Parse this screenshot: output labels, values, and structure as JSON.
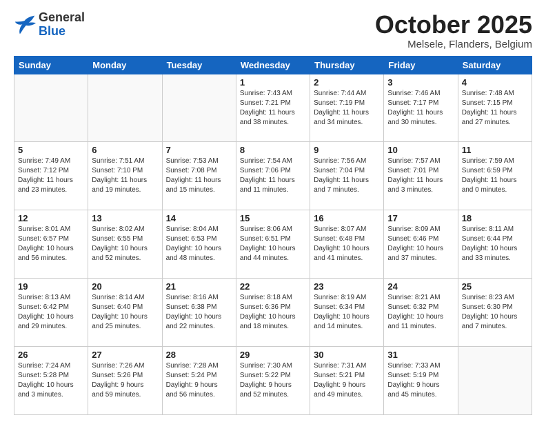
{
  "logo": {
    "general": "General",
    "blue": "Blue"
  },
  "header": {
    "month_year": "October 2025",
    "location": "Melsele, Flanders, Belgium"
  },
  "weekdays": [
    "Sunday",
    "Monday",
    "Tuesday",
    "Wednesday",
    "Thursday",
    "Friday",
    "Saturday"
  ],
  "weeks": [
    [
      {
        "day": "",
        "info": ""
      },
      {
        "day": "",
        "info": ""
      },
      {
        "day": "",
        "info": ""
      },
      {
        "day": "1",
        "info": "Sunrise: 7:43 AM\nSunset: 7:21 PM\nDaylight: 11 hours\nand 38 minutes."
      },
      {
        "day": "2",
        "info": "Sunrise: 7:44 AM\nSunset: 7:19 PM\nDaylight: 11 hours\nand 34 minutes."
      },
      {
        "day": "3",
        "info": "Sunrise: 7:46 AM\nSunset: 7:17 PM\nDaylight: 11 hours\nand 30 minutes."
      },
      {
        "day": "4",
        "info": "Sunrise: 7:48 AM\nSunset: 7:15 PM\nDaylight: 11 hours\nand 27 minutes."
      }
    ],
    [
      {
        "day": "5",
        "info": "Sunrise: 7:49 AM\nSunset: 7:12 PM\nDaylight: 11 hours\nand 23 minutes."
      },
      {
        "day": "6",
        "info": "Sunrise: 7:51 AM\nSunset: 7:10 PM\nDaylight: 11 hours\nand 19 minutes."
      },
      {
        "day": "7",
        "info": "Sunrise: 7:53 AM\nSunset: 7:08 PM\nDaylight: 11 hours\nand 15 minutes."
      },
      {
        "day": "8",
        "info": "Sunrise: 7:54 AM\nSunset: 7:06 PM\nDaylight: 11 hours\nand 11 minutes."
      },
      {
        "day": "9",
        "info": "Sunrise: 7:56 AM\nSunset: 7:04 PM\nDaylight: 11 hours\nand 7 minutes."
      },
      {
        "day": "10",
        "info": "Sunrise: 7:57 AM\nSunset: 7:01 PM\nDaylight: 11 hours\nand 3 minutes."
      },
      {
        "day": "11",
        "info": "Sunrise: 7:59 AM\nSunset: 6:59 PM\nDaylight: 11 hours\nand 0 minutes."
      }
    ],
    [
      {
        "day": "12",
        "info": "Sunrise: 8:01 AM\nSunset: 6:57 PM\nDaylight: 10 hours\nand 56 minutes."
      },
      {
        "day": "13",
        "info": "Sunrise: 8:02 AM\nSunset: 6:55 PM\nDaylight: 10 hours\nand 52 minutes."
      },
      {
        "day": "14",
        "info": "Sunrise: 8:04 AM\nSunset: 6:53 PM\nDaylight: 10 hours\nand 48 minutes."
      },
      {
        "day": "15",
        "info": "Sunrise: 8:06 AM\nSunset: 6:51 PM\nDaylight: 10 hours\nand 44 minutes."
      },
      {
        "day": "16",
        "info": "Sunrise: 8:07 AM\nSunset: 6:48 PM\nDaylight: 10 hours\nand 41 minutes."
      },
      {
        "day": "17",
        "info": "Sunrise: 8:09 AM\nSunset: 6:46 PM\nDaylight: 10 hours\nand 37 minutes."
      },
      {
        "day": "18",
        "info": "Sunrise: 8:11 AM\nSunset: 6:44 PM\nDaylight: 10 hours\nand 33 minutes."
      }
    ],
    [
      {
        "day": "19",
        "info": "Sunrise: 8:13 AM\nSunset: 6:42 PM\nDaylight: 10 hours\nand 29 minutes."
      },
      {
        "day": "20",
        "info": "Sunrise: 8:14 AM\nSunset: 6:40 PM\nDaylight: 10 hours\nand 25 minutes."
      },
      {
        "day": "21",
        "info": "Sunrise: 8:16 AM\nSunset: 6:38 PM\nDaylight: 10 hours\nand 22 minutes."
      },
      {
        "day": "22",
        "info": "Sunrise: 8:18 AM\nSunset: 6:36 PM\nDaylight: 10 hours\nand 18 minutes."
      },
      {
        "day": "23",
        "info": "Sunrise: 8:19 AM\nSunset: 6:34 PM\nDaylight: 10 hours\nand 14 minutes."
      },
      {
        "day": "24",
        "info": "Sunrise: 8:21 AM\nSunset: 6:32 PM\nDaylight: 10 hours\nand 11 minutes."
      },
      {
        "day": "25",
        "info": "Sunrise: 8:23 AM\nSunset: 6:30 PM\nDaylight: 10 hours\nand 7 minutes."
      }
    ],
    [
      {
        "day": "26",
        "info": "Sunrise: 7:24 AM\nSunset: 5:28 PM\nDaylight: 10 hours\nand 3 minutes."
      },
      {
        "day": "27",
        "info": "Sunrise: 7:26 AM\nSunset: 5:26 PM\nDaylight: 9 hours\nand 59 minutes."
      },
      {
        "day": "28",
        "info": "Sunrise: 7:28 AM\nSunset: 5:24 PM\nDaylight: 9 hours\nand 56 minutes."
      },
      {
        "day": "29",
        "info": "Sunrise: 7:30 AM\nSunset: 5:22 PM\nDaylight: 9 hours\nand 52 minutes."
      },
      {
        "day": "30",
        "info": "Sunrise: 7:31 AM\nSunset: 5:21 PM\nDaylight: 9 hours\nand 49 minutes."
      },
      {
        "day": "31",
        "info": "Sunrise: 7:33 AM\nSunset: 5:19 PM\nDaylight: 9 hours\nand 45 minutes."
      },
      {
        "day": "",
        "info": ""
      }
    ]
  ]
}
